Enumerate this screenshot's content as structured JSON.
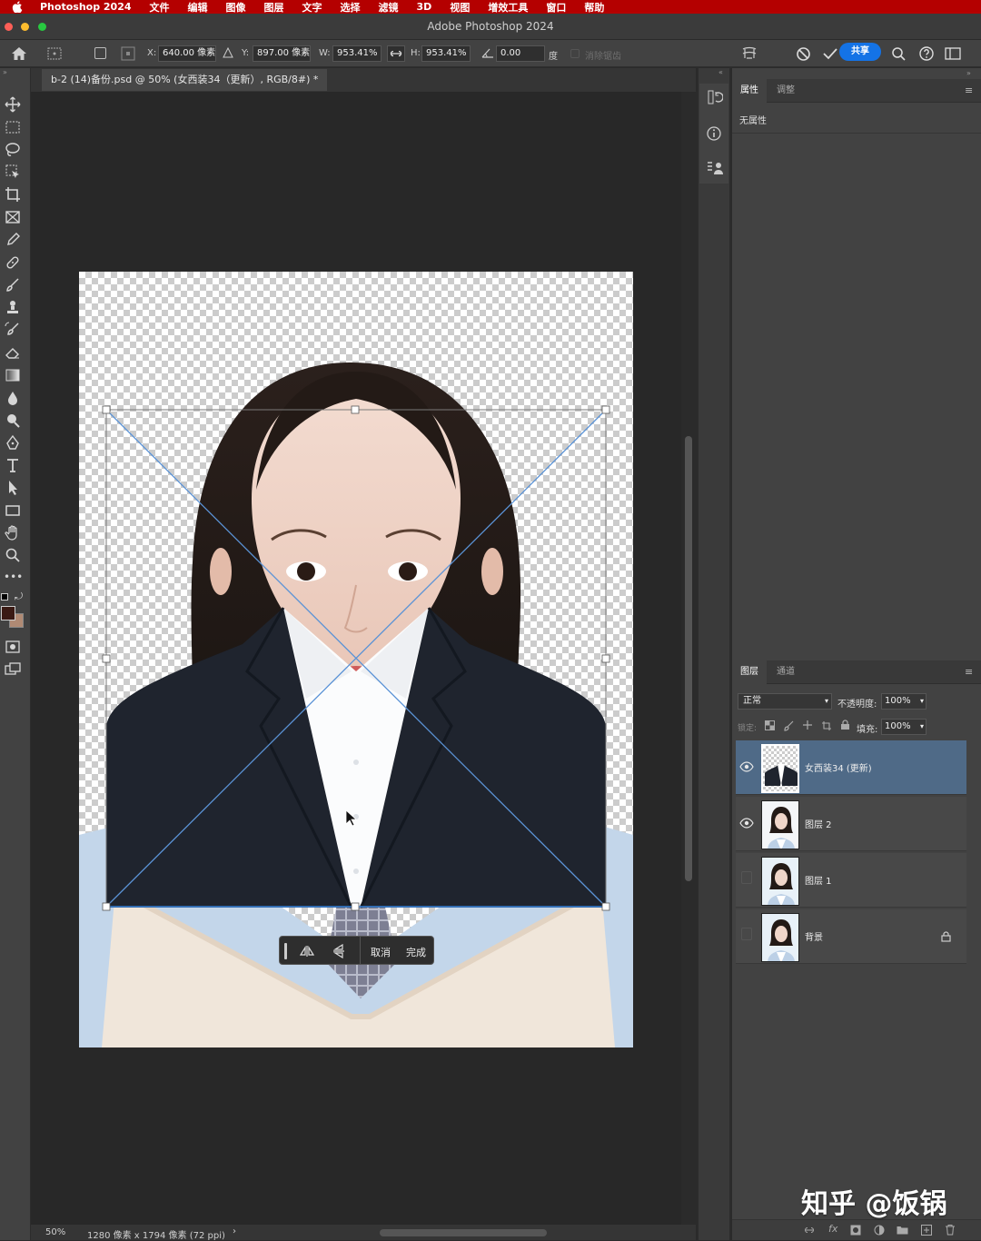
{
  "menubar": {
    "app": "Photoshop 2024",
    "items": [
      "文件",
      "编辑",
      "图像",
      "图层",
      "文字",
      "选择",
      "滤镜",
      "3D",
      "视图",
      "增效工具",
      "窗口",
      "帮助"
    ]
  },
  "window": {
    "title": "Adobe Photoshop 2024"
  },
  "options": {
    "x_label": "X:",
    "x_value": "640.00 像素",
    "y_label": "Y:",
    "y_value": "897.00 像素",
    "w_label": "W:",
    "w_value": "953.41%",
    "h_label": "H:",
    "h_value": "953.41%",
    "angle_value": "0.00",
    "angle_unit": "度",
    "interp_label": "消除锯齿",
    "share_label": "共享"
  },
  "document": {
    "tab_title": "b-2 (14)备份.psd @ 50% (女西装34（更新）, RGB/8#) *"
  },
  "floatbar": {
    "cancel": "取消",
    "done": "完成"
  },
  "properties": {
    "tab_properties": "属性",
    "tab_adjust": "调整",
    "no_properties": "无属性"
  },
  "layers_panel": {
    "tab_layers": "图层",
    "tab_channels": "通道",
    "blend_mode": "正常",
    "opacity_label": "不透明度:",
    "opacity_value": "100%",
    "lock_label": "锁定:",
    "fill_label": "填充:",
    "fill_value": "100%",
    "layers": [
      {
        "name": "女西装34 (更新)",
        "visible": true,
        "selected": true
      },
      {
        "name": "图层 2",
        "visible": true,
        "selected": false
      },
      {
        "name": "图层 1",
        "visible": false,
        "selected": false
      },
      {
        "name": "背景",
        "visible": false,
        "selected": false,
        "locked": true
      }
    ]
  },
  "status": {
    "zoom": "50%",
    "doc_info": "1280 像素 x 1794 像素 (72 ppi)"
  },
  "watermark": "知乎 @饭锅",
  "colors": {
    "menubar_bg": "#b40000",
    "accent_blue": "#1473e6",
    "selected_layer": "#4f6a87",
    "foreground_swatch": "#3a1a14",
    "background_swatch": "#b08a74"
  }
}
